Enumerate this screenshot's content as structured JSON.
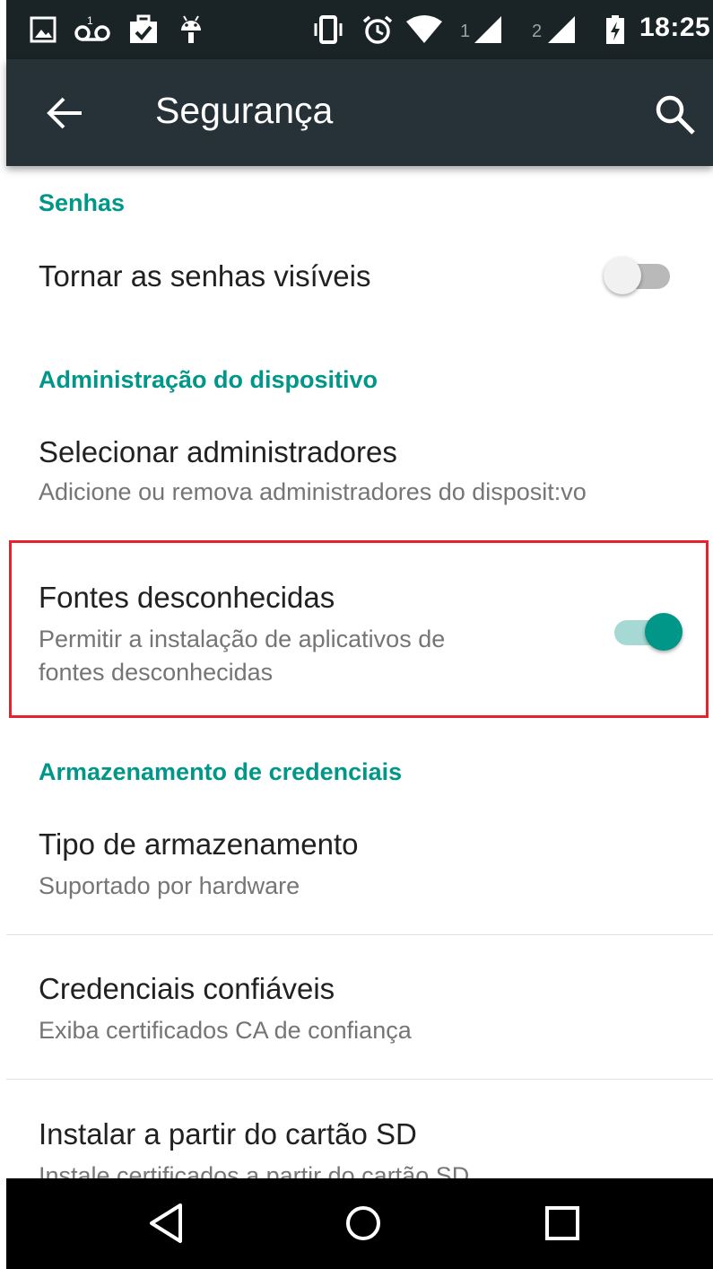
{
  "status_bar": {
    "time": "18:25",
    "sim1": "1",
    "sim2": "2",
    "icons": [
      "image-icon",
      "voicemail-icon",
      "briefcase-check-icon",
      "android-icon",
      "vibrate-icon",
      "alarm-icon",
      "wifi-icon",
      "signal-icon",
      "signal-icon",
      "battery-charging-icon"
    ]
  },
  "toolbar": {
    "title": "Segurança",
    "back_icon": "arrow-left-icon",
    "search_icon": "search-icon"
  },
  "sections": {
    "passwords": {
      "header": "Senhas",
      "items": [
        {
          "title": "Tornar as senhas visíveis",
          "switch_on": false
        }
      ]
    },
    "device_admin": {
      "header": "Administração do dispositivo",
      "items": [
        {
          "title": "Selecionar administradores",
          "subtitle": "Adicione ou remova administradores do disposit:vo"
        },
        {
          "title": "Fontes desconhecidas",
          "subtitle_line1": "Permitir a instalação de aplicativos de",
          "subtitle_line2": "fontes desconhecidas",
          "switch_on": true
        }
      ]
    },
    "credentials": {
      "header": "Armazenamento de credenciais",
      "items": [
        {
          "title": "Tipo de armazenamento",
          "subtitle": "Suportado por hardware"
        },
        {
          "title": "Credenciais confiáveis",
          "subtitle": "Exiba certificados CA de confiança"
        },
        {
          "title": "Instalar a partir do cartão SD",
          "subtitle": "Instale certificados a partir do cartão SD"
        }
      ]
    }
  },
  "colors": {
    "accent": "#009688",
    "toolbar": "#263238",
    "status_bar": "#1a2326",
    "highlight": "#e5222d"
  },
  "nav_bar": {
    "icons": [
      "back-triangle-icon",
      "home-circle-icon",
      "recents-square-icon"
    ]
  }
}
